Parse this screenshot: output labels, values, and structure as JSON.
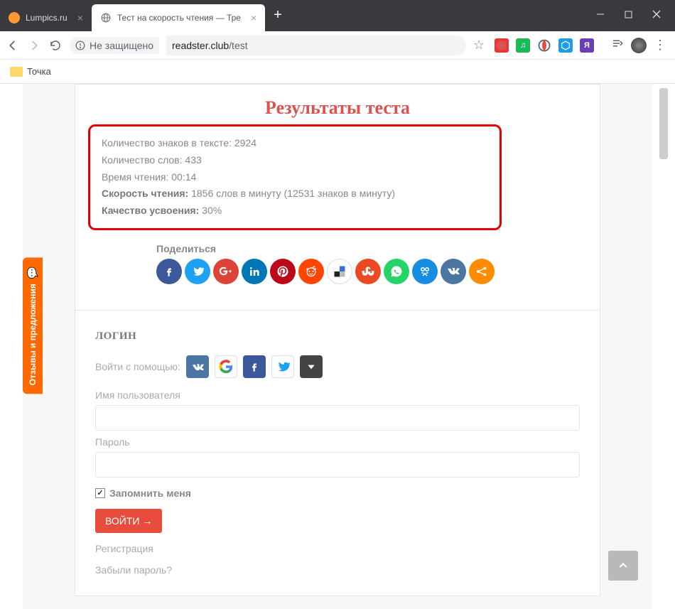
{
  "chrome": {
    "tabs": [
      {
        "title": "Lumpics.ru"
      },
      {
        "title": "Тест на скорость чтения — Тре"
      }
    ],
    "security_text": "Не защищено",
    "url_domain": "readster.club",
    "url_path": "/test",
    "bookmark": "Точка"
  },
  "results": {
    "title": "Результаты теста",
    "chars_label": "Количество знаков в тексте:",
    "chars_value": "2924",
    "words_label": "Количество слов:",
    "words_value": "433",
    "time_label": "Время чтения:",
    "time_value": "00:14",
    "speed_label": "Скорость чтения:",
    "speed_value": "1856 слов в минуту (12531 знаков в минуту)",
    "quality_label": "Качество усвоения:",
    "quality_value": "30%",
    "share_title": "Поделиться"
  },
  "login": {
    "heading": "ЛОГИН",
    "social_label": "Войти с помощью:",
    "username_label": "Имя пользователя",
    "password_label": "Пароль",
    "remember_label": "Запомнить меня",
    "submit": "ВОЙТИ →",
    "register_link": "Регистрация",
    "forgot_link": "Забыли пароль?"
  },
  "feedback_tab": "Отзывы и предложения"
}
